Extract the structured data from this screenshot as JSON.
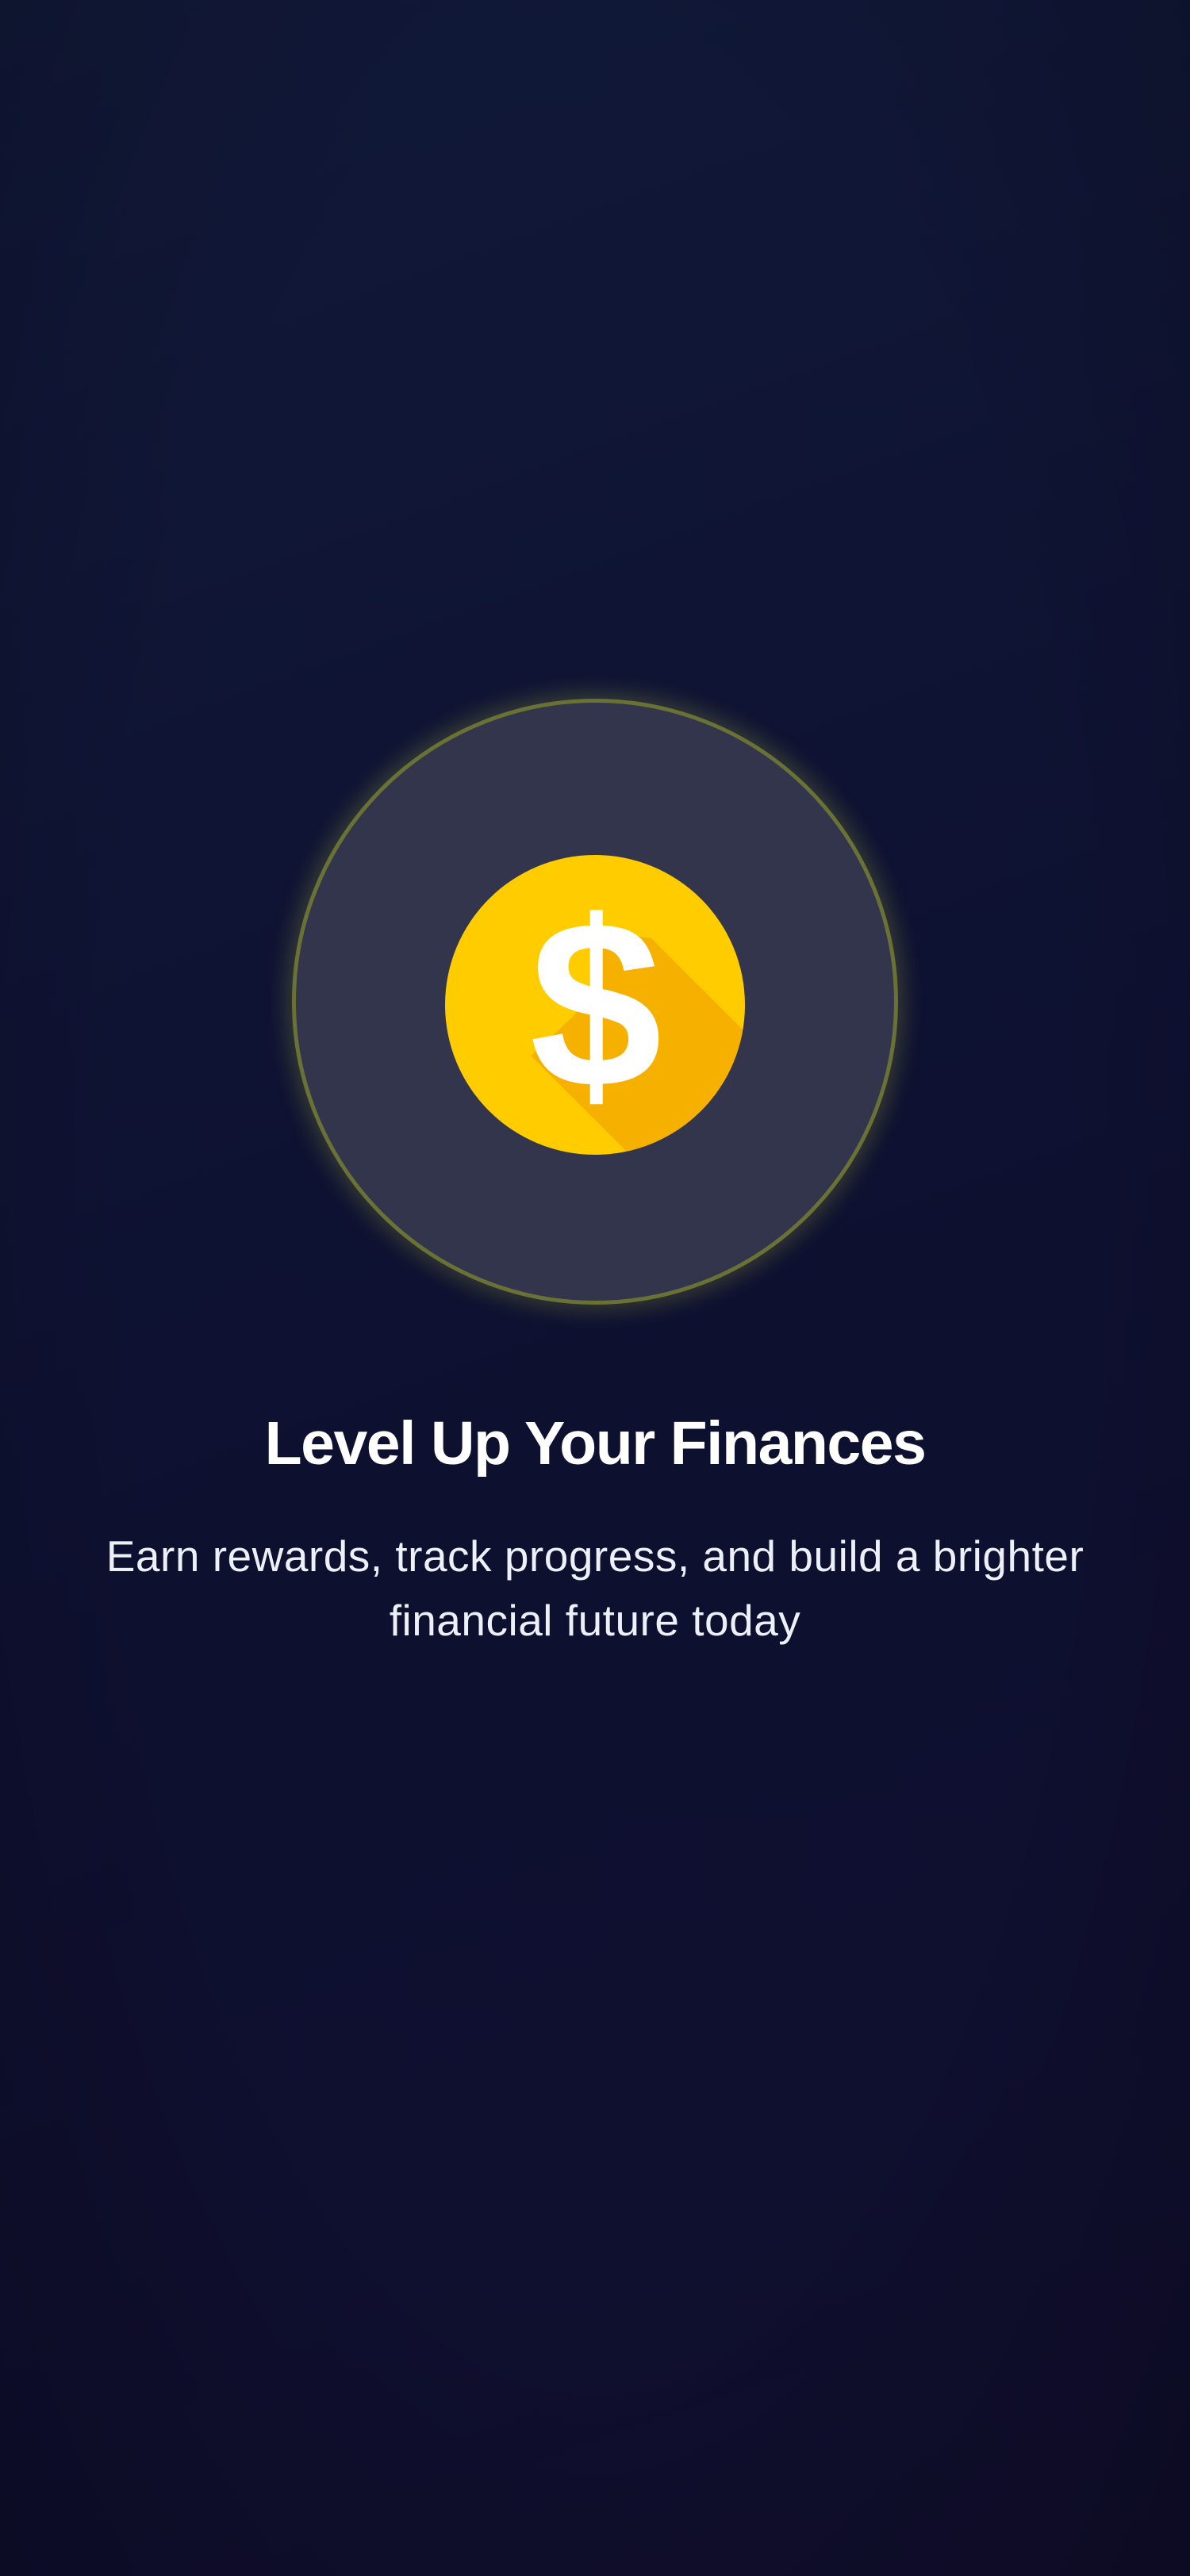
{
  "onboarding": {
    "hero": {
      "icon": "dollar-coin-icon",
      "coin_symbol": "$"
    },
    "title": "Level Up Your Finances",
    "subtitle": "Earn rewards, track progress, and build a brighter financial future today"
  },
  "colors": {
    "background": "#0f1434",
    "ring_fill": "#32354c",
    "ring_glow": "#c4cd3c",
    "coin_gold": "#ffcc00",
    "coin_shadow": "#f6b100",
    "text_primary": "#ffffff"
  }
}
